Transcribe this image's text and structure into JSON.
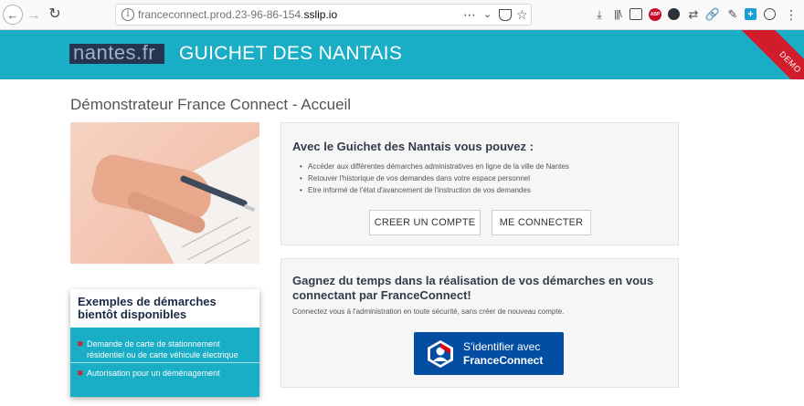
{
  "browser": {
    "url_prefix": "franceconnect.prod.23-96-86-154.",
    "url_host": "sslip.io",
    "info_icon": "info-icon",
    "more_icon": "more-icon",
    "toolbar_icons": [
      "download-icon",
      "library-icon",
      "sidebar-icon",
      "adblock-icon",
      "darkreader-icon",
      "sync-icon",
      "link-icon",
      "pen-icon",
      "addon-icon",
      "account-icon",
      "menu-icon"
    ],
    "adblock_label": "ABP"
  },
  "header": {
    "logo": "nantes.fr",
    "title": "GUICHET DES NANTAIS",
    "ribbon": "DEMO"
  },
  "page": {
    "heading": "Démonstrateur France Connect - Accueil"
  },
  "examples": {
    "title": "Exemples de démarches bientôt disponibles",
    "items": [
      "Demande de carte de stationnement résidentiel ou de carte véhicule électrique",
      "Autorisation pour un déménagement"
    ]
  },
  "panel_guichet": {
    "title": "Avec le Guichet des Nantais vous pouvez :",
    "items": [
      "Accéder aux différentes démarches administratives en ligne de la ville de Nantes",
      "Retouver l'historique de vos demandes dans votre espace personnel",
      "Etre informé de l'état d'avancement de l'instruction de vos demandes"
    ],
    "create_account": "CREER UN COMPTE",
    "login": "ME CONNECTER"
  },
  "panel_franceconnect": {
    "title": "Gagnez du temps dans la réalisation de vos démarches en vous connectant par FranceConnect!",
    "text": "Connectez vous à l'administration en toute sécurité, sans créer de nouveau compte.",
    "button_line1": "S'identifier avec",
    "button_line2": "FranceConnect"
  },
  "colors": {
    "header_bg": "#1aaec6",
    "ribbon_bg": "#d11d2b",
    "franceconnect_bg": "#034ea2",
    "logo_bg": "#24364f"
  }
}
